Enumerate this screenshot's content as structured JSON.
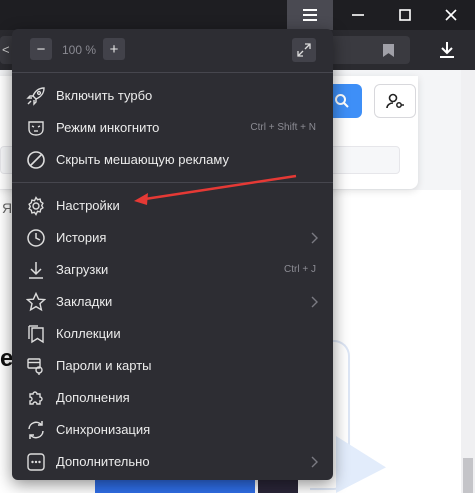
{
  "browser": {
    "address_fragment": "< -"
  },
  "zoom": {
    "minus_label": "−",
    "plus_label": "+",
    "value": "100 %"
  },
  "menu": {
    "items": [
      {
        "label": "Включить турбо",
        "icon": "rocket-icon"
      },
      {
        "label": "Режим инкогнито",
        "icon": "incognito-mask-icon",
        "hotkey": "Ctrl + Shift + N"
      },
      {
        "label": "Скрыть мешающую рекламу",
        "icon": "block-ads-icon"
      },
      {
        "label": "Настройки",
        "icon": "gear-icon"
      },
      {
        "label": "История",
        "icon": "clock-icon",
        "submenu": true
      },
      {
        "label": "Загрузки",
        "icon": "download-icon",
        "hotkey": "Ctrl + J"
      },
      {
        "label": "Закладки",
        "icon": "star-icon",
        "submenu": true
      },
      {
        "label": "Коллекции",
        "icon": "collections-icon"
      },
      {
        "label": "Пароли и карты",
        "icon": "passwords-cards-icon"
      },
      {
        "label": "Дополнения",
        "icon": "puzzle-icon"
      },
      {
        "label": "Синхронизация",
        "icon": "sync-icon"
      },
      {
        "label": "Дополнительно",
        "icon": "more-dots-icon",
        "submenu": true
      }
    ]
  },
  "page": {
    "side_letter": "Я",
    "side_char": "e"
  },
  "annotation": {
    "arrow_color": "#e53935",
    "points_to": "Настройки"
  },
  "colors": {
    "menu_bg": "#2d2d33",
    "accent_blue": "#3e8ff7"
  }
}
